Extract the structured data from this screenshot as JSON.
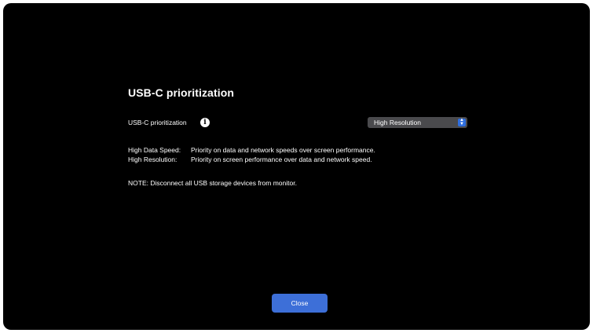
{
  "dialog": {
    "title": "USB-C prioritization",
    "setting": {
      "label": "USB-C prioritization",
      "info_icon": "info-icon",
      "selected_value": "High Resolution",
      "select_icon": "up-down-chevron-icon"
    },
    "descriptions": [
      {
        "key": "High Data Speed:",
        "text": "Priority on data and network speeds over screen performance."
      },
      {
        "key": "High Resolution:",
        "text": "Priority on screen performance over data and network speed."
      }
    ],
    "note": "NOTE: Disconnect all USB storage devices from monitor.",
    "close_label": "Close"
  },
  "colors": {
    "background": "#000000",
    "accent": "#3d6fd8",
    "select_bg": "#4a4a4d"
  }
}
